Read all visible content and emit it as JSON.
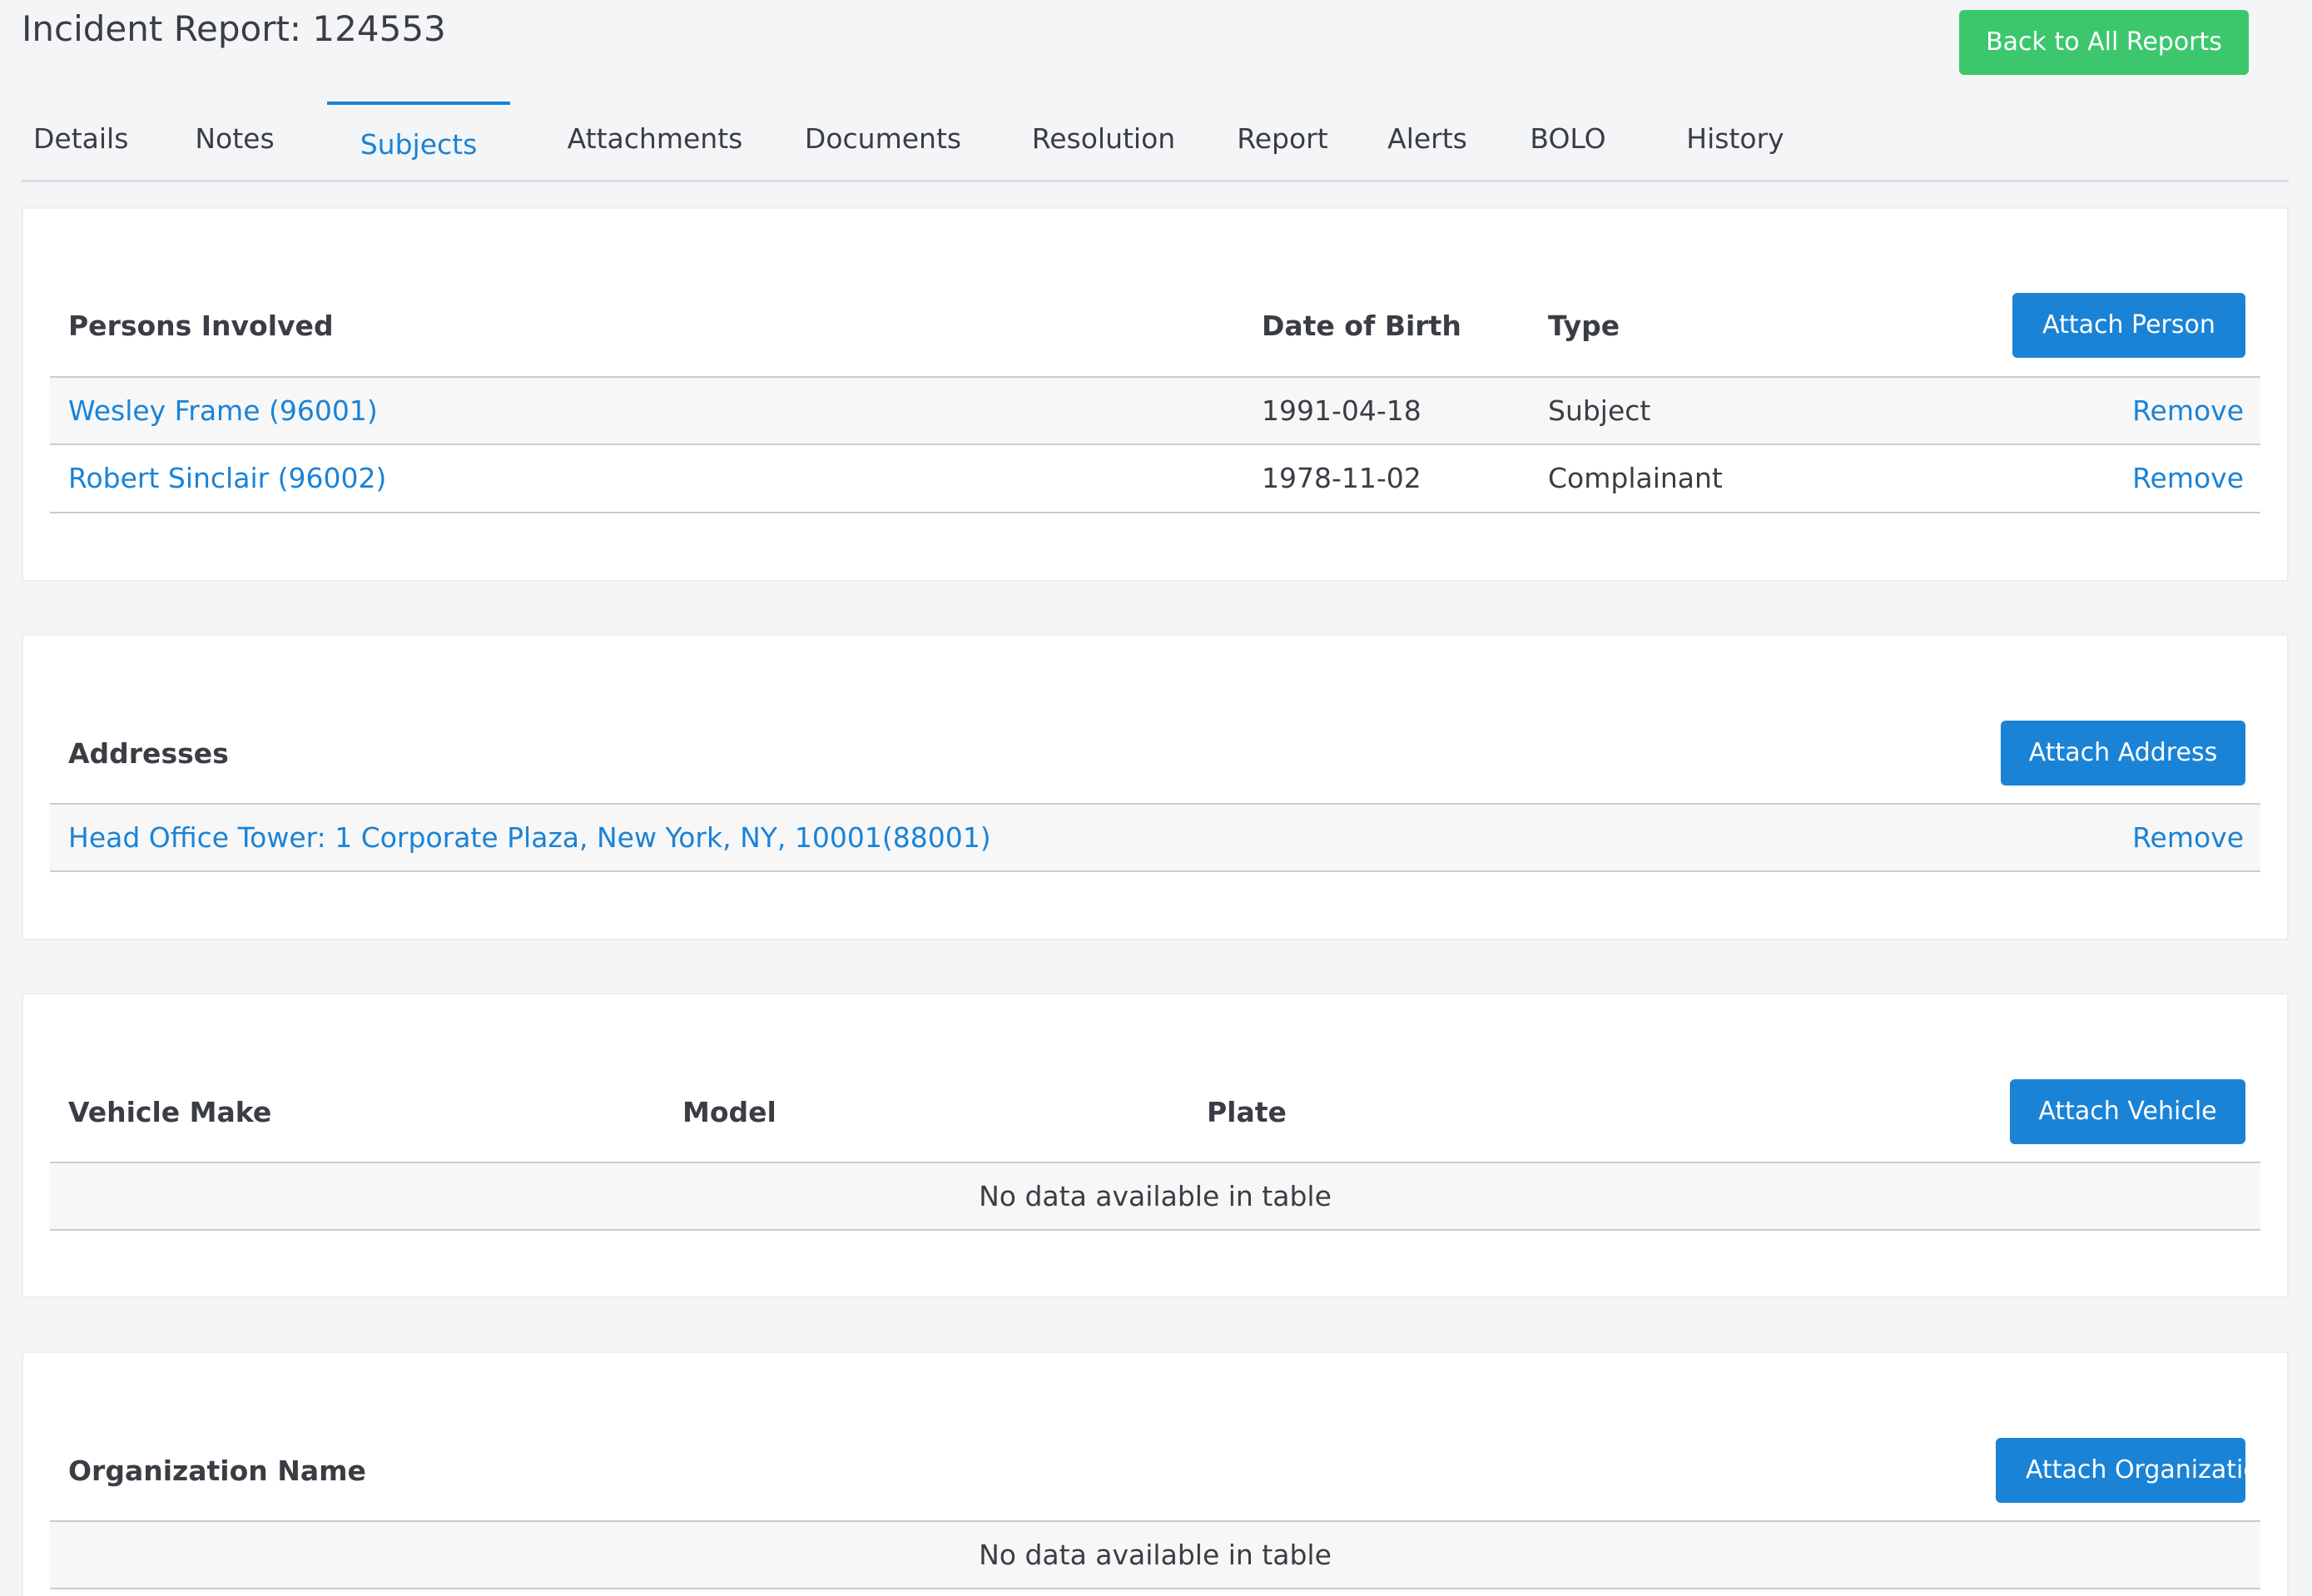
{
  "header": {
    "title": "Incident Report: 124553",
    "back_label": "Back to All Reports"
  },
  "tabs": [
    {
      "label": "Details"
    },
    {
      "label": "Notes"
    },
    {
      "label": "Subjects",
      "active": true
    },
    {
      "label": "Attachments"
    },
    {
      "label": "Documents"
    },
    {
      "label": "Resolution"
    },
    {
      "label": "Report"
    },
    {
      "label": "Alerts"
    },
    {
      "label": "BOLO"
    },
    {
      "label": "History"
    }
  ],
  "persons": {
    "columns": {
      "name": "Persons Involved",
      "dob": "Date of Birth",
      "type": "Type"
    },
    "attach_label": "Attach Person",
    "rows": [
      {
        "name": "Wesley Frame (96001)",
        "dob": "1991-04-18",
        "type": "Subject",
        "action": "Remove"
      },
      {
        "name": "Robert Sinclair (96002)",
        "dob": "1978-11-02",
        "type": "Complainant",
        "action": "Remove"
      }
    ]
  },
  "addresses": {
    "columns": {
      "address": "Addresses"
    },
    "attach_label": "Attach Address",
    "rows": [
      {
        "address": "Head Office Tower: 1 Corporate Plaza, New York, NY, 10001(88001)",
        "action": "Remove"
      }
    ]
  },
  "vehicles": {
    "columns": {
      "make": "Vehicle Make",
      "model": "Model",
      "plate": "Plate"
    },
    "attach_label": "Attach Vehicle",
    "empty_text": "No data available in table"
  },
  "organizations": {
    "columns": {
      "name": "Organization Name"
    },
    "attach_label": "Attach Organization",
    "empty_text": "No data available in table"
  },
  "colors": {
    "primary": "#1a83d6",
    "success": "#3cc76d",
    "background": "#f4f5f7",
    "text": "#3a3d44"
  }
}
